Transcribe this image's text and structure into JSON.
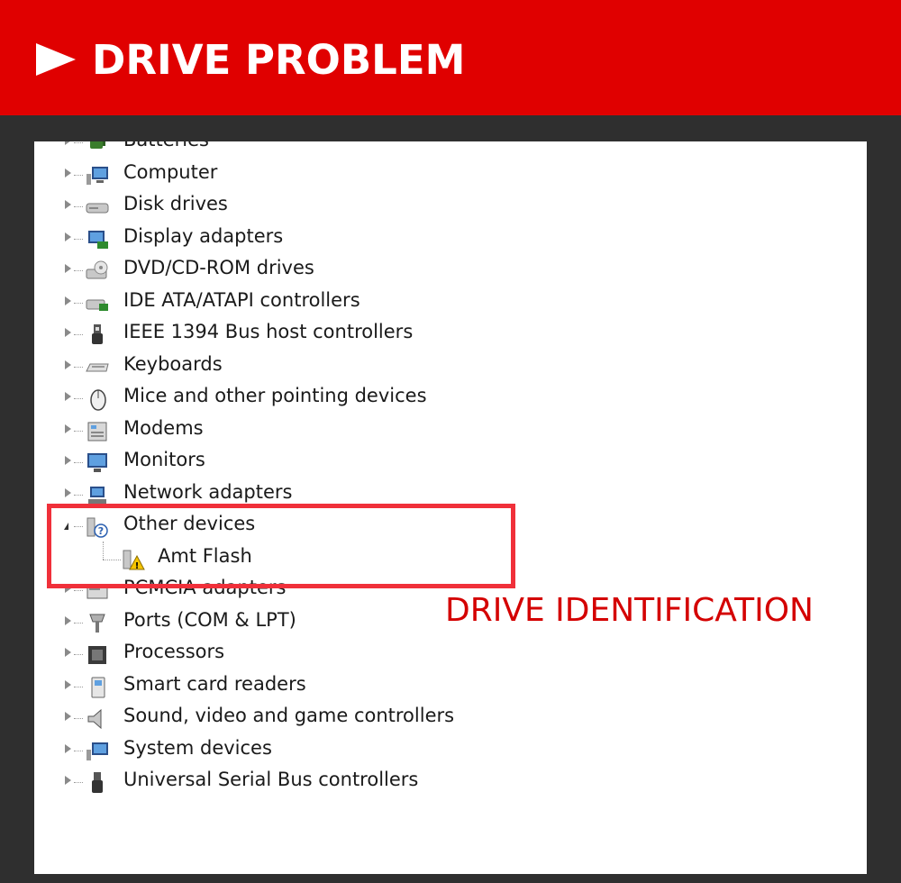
{
  "banner": {
    "title": "DRIVE PROBLEM",
    "arrow_icon": "arrow-right-icon",
    "bg_color": "#e00000"
  },
  "annotation": {
    "text": "DRIVE IDENTIFICATION",
    "color": "#d40000"
  },
  "highlight": {
    "color": "#f0303a"
  },
  "tree": {
    "items": [
      {
        "label": "Batteries",
        "icon": "battery-icon",
        "expanded": false
      },
      {
        "label": "Computer",
        "icon": "computer-icon",
        "expanded": false
      },
      {
        "label": "Disk drives",
        "icon": "disk-drive-icon",
        "expanded": false
      },
      {
        "label": "Display adapters",
        "icon": "display-adapter-icon",
        "expanded": false
      },
      {
        "label": "DVD/CD-ROM drives",
        "icon": "dvd-drive-icon",
        "expanded": false
      },
      {
        "label": "IDE ATA/ATAPI controllers",
        "icon": "ide-controller-icon",
        "expanded": false
      },
      {
        "label": "IEEE 1394 Bus host controllers",
        "icon": "firewire-icon",
        "expanded": false
      },
      {
        "label": "Keyboards",
        "icon": "keyboard-icon",
        "expanded": false
      },
      {
        "label": "Mice and other pointing devices",
        "icon": "mouse-icon",
        "expanded": false
      },
      {
        "label": "Modems",
        "icon": "modem-icon",
        "expanded": false
      },
      {
        "label": "Monitors",
        "icon": "monitor-icon",
        "expanded": false
      },
      {
        "label": "Network adapters",
        "icon": "network-adapter-icon",
        "expanded": false
      },
      {
        "label": "Other devices",
        "icon": "unknown-device-icon",
        "expanded": true
      },
      {
        "label": "Amt Flash",
        "icon": "warning-device-icon",
        "child": true
      },
      {
        "label": "PCMCIA adapters",
        "icon": "pcmcia-icon",
        "expanded": false
      },
      {
        "label": "Ports (COM & LPT)",
        "icon": "port-icon",
        "expanded": false
      },
      {
        "label": "Processors",
        "icon": "processor-icon",
        "expanded": false
      },
      {
        "label": "Smart card readers",
        "icon": "smart-card-icon",
        "expanded": false
      },
      {
        "label": "Sound, video and game controllers",
        "icon": "speaker-icon",
        "expanded": false
      },
      {
        "label": "System devices",
        "icon": "system-device-icon",
        "expanded": false
      },
      {
        "label": "Universal Serial Bus controllers",
        "icon": "usb-icon",
        "expanded": false
      }
    ]
  }
}
